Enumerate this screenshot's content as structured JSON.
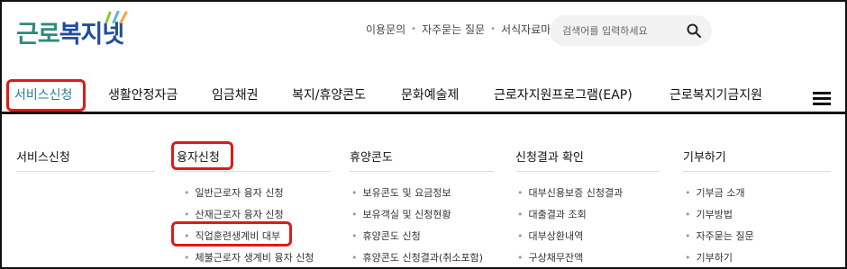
{
  "logo": {
    "part1": "근로",
    "part2": "복지넷"
  },
  "top_links": [
    "이용문의",
    "자주묻는 질문",
    "서식자료마당"
  ],
  "search": {
    "placeholder": "검색어를 입력하세요"
  },
  "gnb": [
    "서비스신청",
    "생활안정자금",
    "임금채권",
    "복지/휴양콘도",
    "문화예술제",
    "근로자지원프로그램(EAP)",
    "근로복지기금지원"
  ],
  "mega": {
    "col1_title": "서비스신청",
    "col2_title": "융자신청",
    "col2_items": [
      "일반근로자 융자 신청",
      "산재근로자 융자 신청",
      "직업훈련생계비 대부",
      "체불근로자 생계비 융자 신청"
    ],
    "col3_title": "휴양콘도",
    "col3_items": [
      "보유콘도 및 요금정보",
      "보유객실 및 신청현황",
      "휴양콘도 신청",
      "휴양콘도 신청결과(취소포함)"
    ],
    "col4_title": "신청결과 확인",
    "col4_items": [
      "대부신용보증 신청결과",
      "대출결과 조회",
      "대부상환내역",
      "구상채무잔액"
    ],
    "col5_title": "기부하기",
    "col5_items": [
      "기부금 소개",
      "기부방법",
      "자주묻는 질문",
      "기부하기"
    ]
  },
  "colors": {
    "highlight_box": "#e21818",
    "active_menu": "#2a7a9a",
    "logo_green": "#2e8b7a",
    "logo_blue": "#1f4e9c"
  },
  "icons": [
    "search-icon",
    "hamburger-menu-icon",
    "leaf-icon"
  ]
}
